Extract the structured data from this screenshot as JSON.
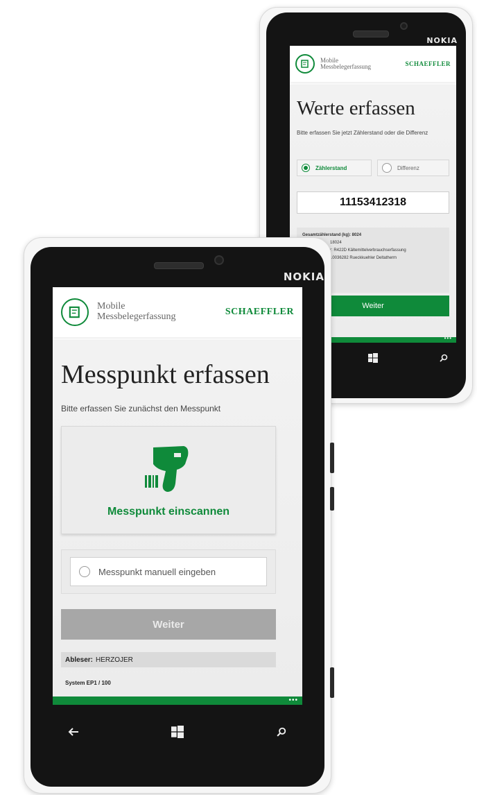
{
  "back_phone": {
    "brand": "NOKIA",
    "header": {
      "app_line1": "Mobile",
      "app_line2": "Messbelegerfassung",
      "company": "SCHAEFFLER"
    },
    "title": "Werte erfassen",
    "instruction": "Bitte erfassen Sie jetzt Zählerstand oder die Differenz",
    "radio_options": [
      {
        "label": "Zählerstand",
        "selected": true
      },
      {
        "label": "Differenz",
        "selected": false
      }
    ],
    "input_value": "11153412318",
    "info_lines": [
      "Gesamtzählerstand (kg): 8024",
      "18024",
      "r: R422D Kältemittelverbrauchserfassung",
      "10036282 Rueckkuehler Deltatherm"
    ],
    "next_button": "Weiter",
    "nav_icons": [
      "windows-icon",
      "search-icon"
    ]
  },
  "front_phone": {
    "brand": "NOKIA",
    "header": {
      "app_line1": "Mobile",
      "app_line2": "Messbelegerfassung",
      "company": "SCHAEFFLER"
    },
    "title": "Messpunkt erfassen",
    "instruction": "Bitte erfassen Sie zunächst den Messpunkt",
    "scan_button": "Messpunkt einscannen",
    "manual_option": "Messpunkt manuell eingeben",
    "next_button": "Weiter",
    "reader_label": "Ableser:",
    "reader_value": "HERZOJER",
    "system_info": "System EP1 / 100",
    "nav_icons": [
      "back-arrow-icon",
      "windows-icon",
      "search-icon"
    ]
  },
  "colors": {
    "accent": "#0f8a3a",
    "disabled_button": "#a7a7a7"
  }
}
